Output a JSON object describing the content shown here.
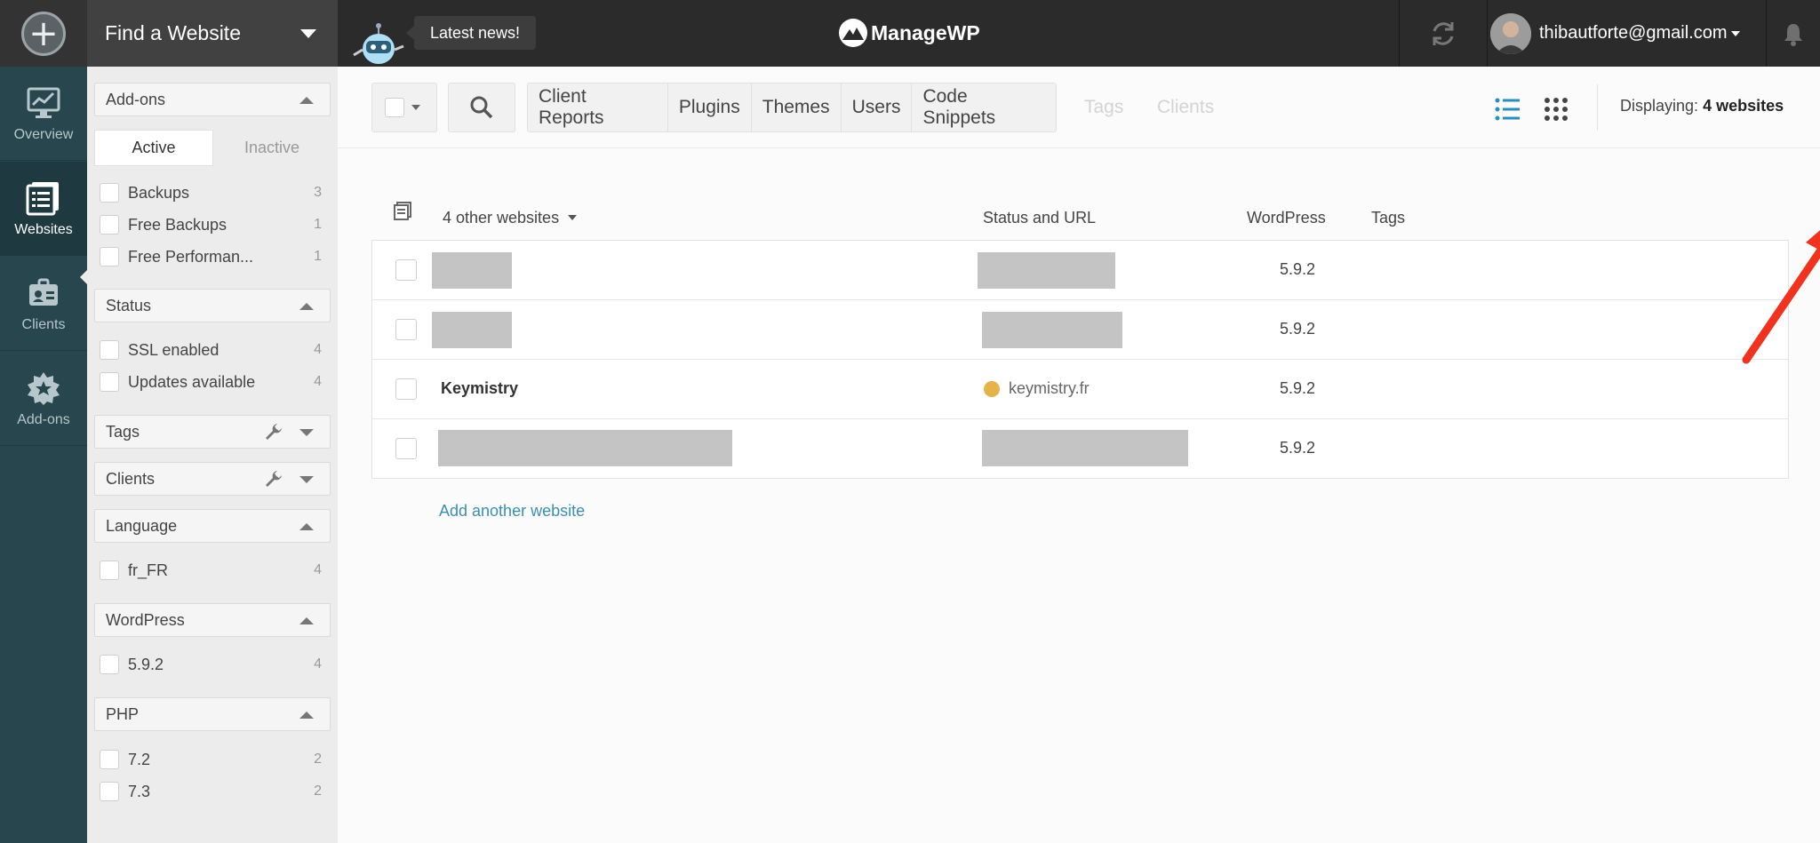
{
  "topbar": {
    "find_website": "Find a Website",
    "news": "Latest news!",
    "logo": "ManageWP",
    "user_email": "thibautforte@gmail.com"
  },
  "leftnav": {
    "items": [
      {
        "label": "Overview",
        "icon": "monitor-chart-icon"
      },
      {
        "label": "Websites",
        "icon": "websites-list-icon",
        "active": true
      },
      {
        "label": "Clients",
        "icon": "client-badge-icon"
      },
      {
        "label": "Add-ons",
        "icon": "addons-gear-star-icon"
      }
    ]
  },
  "filters": {
    "addons": {
      "title": "Add-ons",
      "tab_active": "Active",
      "tab_inactive": "Inactive",
      "items": [
        {
          "label": "Backups",
          "count": "3"
        },
        {
          "label": "Free Backups",
          "count": "1"
        },
        {
          "label": "Free Performan...",
          "count": "1"
        }
      ]
    },
    "status": {
      "title": "Status",
      "items": [
        {
          "label": "SSL enabled",
          "count": "4"
        },
        {
          "label": "Updates available",
          "count": "4"
        }
      ]
    },
    "tags": {
      "title": "Tags"
    },
    "clients": {
      "title": "Clients"
    },
    "language": {
      "title": "Language",
      "items": [
        {
          "label": "fr_FR",
          "count": "4"
        }
      ]
    },
    "wordpress": {
      "title": "WordPress",
      "items": [
        {
          "label": "5.9.2",
          "count": "4"
        }
      ]
    },
    "php": {
      "title": "PHP",
      "items": [
        {
          "label": "7.2",
          "count": "2"
        },
        {
          "label": "7.3",
          "count": "2"
        }
      ]
    }
  },
  "toolbar": {
    "tabs": [
      "Client Reports",
      "Plugins",
      "Themes",
      "Users",
      "Code Snippets"
    ],
    "ghost_tabs": [
      "Tags",
      "Clients"
    ],
    "displaying_label": "Displaying:",
    "displaying_value": "4 websites"
  },
  "table": {
    "group_label": "4 other websites",
    "col_status": "Status and URL",
    "col_wordpress": "WordPress",
    "col_tags": "Tags",
    "rows": [
      {
        "name": "",
        "url": "",
        "wp": "5.9.2"
      },
      {
        "name": "",
        "url": "",
        "wp": "5.9.2"
      },
      {
        "name": "Keymistry",
        "url": "keymistry.fr",
        "wp": "5.9.2"
      },
      {
        "name": "",
        "url": "",
        "wp": "5.9.2"
      }
    ],
    "add_link": "Add another website"
  },
  "colors": {
    "topbar": "#2b2b2b",
    "leftnav": "#27464d",
    "accent_blue": "#3b8fb2",
    "arrow_red": "#f0321e"
  }
}
